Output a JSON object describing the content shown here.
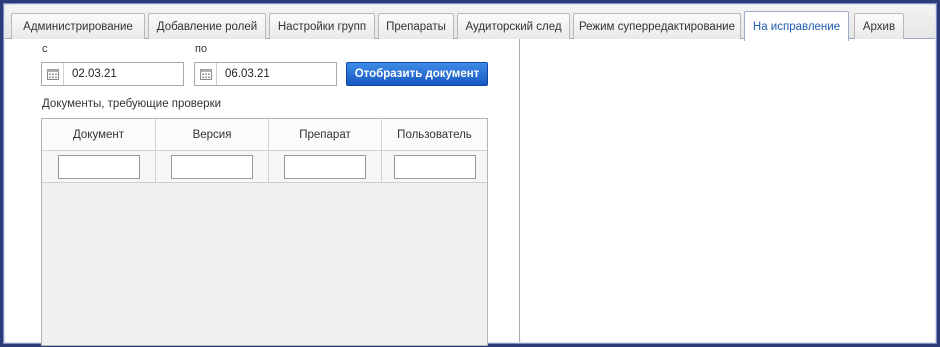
{
  "tabs": [
    {
      "label": "Администрирование",
      "active": false
    },
    {
      "label": "Добавление ролей",
      "active": false
    },
    {
      "label": "Настройки групп",
      "active": false
    },
    {
      "label": "Препараты",
      "active": false
    },
    {
      "label": "Аудиторский след",
      "active": false
    },
    {
      "label": "Режим суперредактирование",
      "active": false
    },
    {
      "label": "На исправление",
      "active": true
    },
    {
      "label": "Архив",
      "active": false
    }
  ],
  "filters": {
    "from_label": "с",
    "to_label": "по",
    "from_value": "02.03.21",
    "to_value": "06.03.21",
    "show_button": "Отобразить документ"
  },
  "section_title": "Документы, требующие проверки",
  "table": {
    "columns": [
      "Документ",
      "Версия",
      "Препарат",
      "Пользователь"
    ],
    "filter_values": [
      "",
      "",
      "",
      ""
    ],
    "rows": []
  },
  "colors": {
    "frame": "#2d3a78",
    "active_tab_text": "#1e5fae",
    "button": "#1658c2"
  },
  "icons": {
    "date_picker": "calendar-icon"
  }
}
